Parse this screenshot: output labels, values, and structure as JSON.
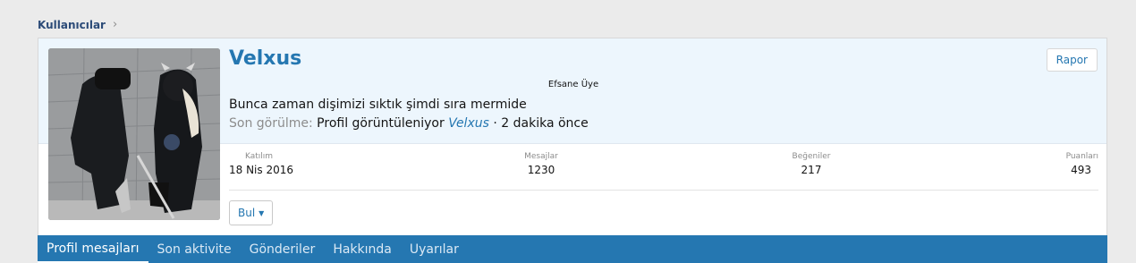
{
  "breadcrumb": {
    "label": "Kullanıcılar",
    "separator": "›"
  },
  "profile": {
    "username": "Velxus",
    "user_title": "Efsane Üye",
    "status_text": "Bunca zaman dişimizi sıktık şimdi sıra mermide",
    "last_seen": {
      "label": "Son görülme:",
      "activity": "Profil görüntüleniyor",
      "target": "Velxus",
      "time": "· 2 dakika önce"
    },
    "report_label": "Rapor",
    "find_label": "Bul",
    "stats": [
      {
        "label": "Katılım",
        "value": "18 Nis 2016"
      },
      {
        "label": "Mesajlar",
        "value": "1230"
      },
      {
        "label": "Beğeniler",
        "value": "217"
      },
      {
        "label": "Puanları",
        "value": "493"
      }
    ]
  },
  "tabs": [
    {
      "label": "Profil mesajları",
      "active": true
    },
    {
      "label": "Son aktivite"
    },
    {
      "label": "Gönderiler"
    },
    {
      "label": "Hakkında"
    },
    {
      "label": "Uyarılar"
    }
  ],
  "colors": {
    "accent": "#2577b1",
    "header_bg": "#edf6fd",
    "tab_bar": "#2577b1"
  }
}
